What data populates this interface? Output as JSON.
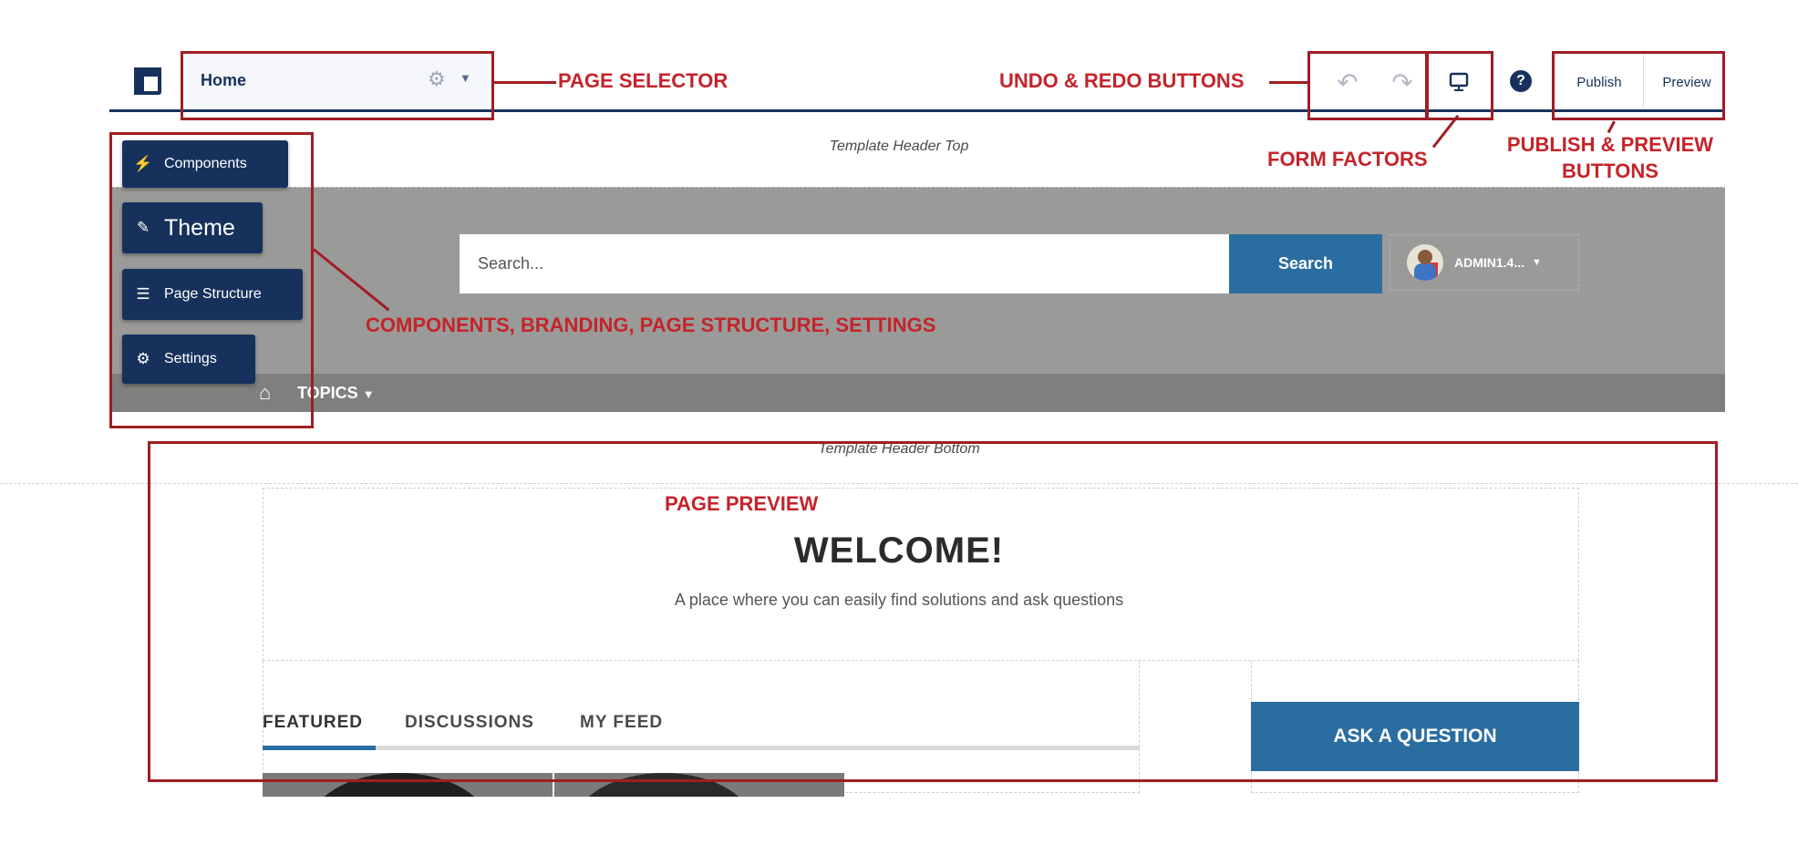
{
  "builder": {
    "page_selector": {
      "value": "Home"
    },
    "publish_label": "Publish",
    "preview_label": "Preview",
    "help_label": "?"
  },
  "sidebar": {
    "components_label": "Components",
    "theme_label": "Theme",
    "page_structure_label": "Page Structure",
    "settings_label": "Settings"
  },
  "template": {
    "header_top": "Template Header Top",
    "header_bottom": "Template Header Bottom",
    "search_placeholder": "Search...",
    "search_button": "Search",
    "user_name": "ADMIN1.4...",
    "topics_label": "TOPICS"
  },
  "page": {
    "welcome_title": "WELCOME!",
    "tagline": "A place where you can easily find solutions and ask questions",
    "tabs": [
      "FEATURED",
      "DISCUSSIONS",
      "MY FEED"
    ],
    "ask_button": "ASK A QUESTION"
  },
  "annotations": {
    "page_selector": "PAGE SELECTOR",
    "undo_redo": "UNDO & REDO BUTTONS",
    "form_factors": "FORM FACTORS",
    "publish_preview": [
      "PUBLISH & PREVIEW",
      "BUTTONS"
    ],
    "sidebar": "COMPONENTS, BRANDING, PAGE STRUCTURE, SETTINGS",
    "page_preview": "PAGE PREVIEW"
  },
  "colors": {
    "navy": "#16325c",
    "salesforce_blue": "#2a6da0",
    "annotation_red": "#a01d24",
    "header_gray": "#9a9b98"
  }
}
